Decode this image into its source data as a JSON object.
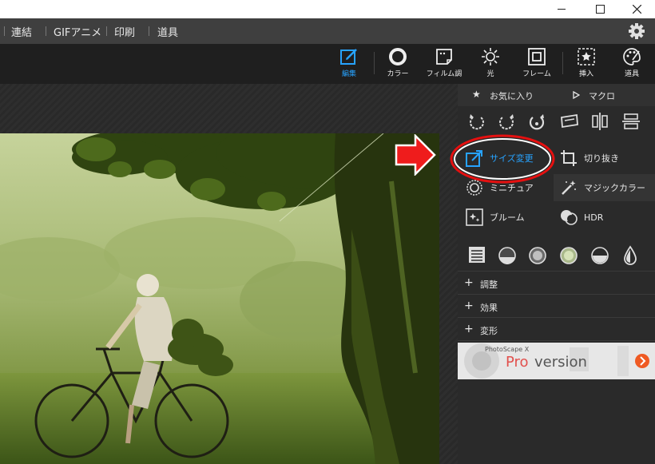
{
  "window_controls": {
    "minimize": "–",
    "maximize": "□",
    "close": "✕"
  },
  "menu": [
    "連結",
    "GIFアニメ",
    "印刷",
    "道具"
  ],
  "toolbar": {
    "edit": "編集",
    "color": "カラー",
    "film": "フィルム調",
    "light": "光",
    "frame": "フレーム",
    "insert": "挿入",
    "tools": "道具"
  },
  "colors": {
    "accent": "#27a3ff",
    "highlight_ring": "#e51010",
    "arrow": "#e51010"
  },
  "panel": {
    "favorites": "お気に入り",
    "macro": "マクロ",
    "resize": "サイズ変更",
    "crop": "切り抜き",
    "miniature": "ミニチュア",
    "magic_color": "マジックカラー",
    "bloom": "ブルーム",
    "hdr": "HDR",
    "adjust": "調整",
    "effects": "効果",
    "transform": "変形"
  },
  "banner": {
    "brand": "PhotoScape X",
    "pro": "Pro",
    "version": "version"
  }
}
